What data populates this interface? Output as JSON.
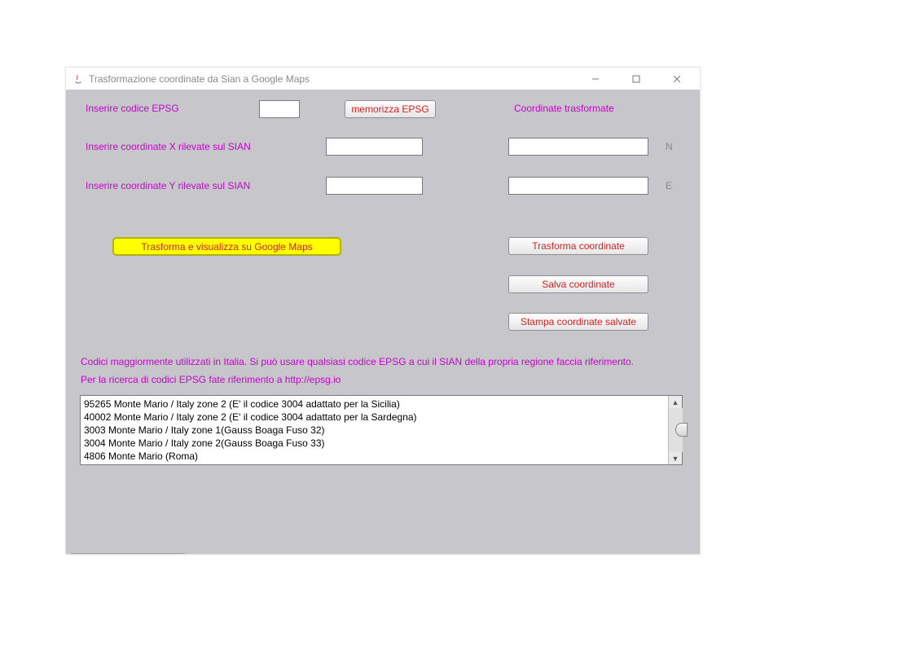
{
  "window": {
    "title": "Trasformazione coordinate da Sian a Google Maps"
  },
  "labels": {
    "epsg": "Inserire codice EPSG",
    "memorizza": "memorizza EPSG",
    "coord_trasformate": "Coordinate trasformate",
    "x_sian": "Inserire coordinate X rilevate sul SIAN",
    "y_sian": "Inserire coordinate Y rilevate sul SIAN",
    "n": "N",
    "e": "E"
  },
  "buttons": {
    "trasforma_visualizza": "Trasforma e visualizza su Google Maps",
    "trasforma_coordinate": "Trasforma coordinate",
    "salva_coordinate": "Salva coordinate",
    "stampa_coordinate": "Stampa coordinate salvate"
  },
  "info": {
    "line1": "Codici maggiormente utilizzati in Italia. Si può usare qualsiasi codice EPSG a cui il SIAN della propria regione faccia riferimento.",
    "line2": "Per la ricerca di codici EPSG fate riferimento a  http://epsg.io"
  },
  "list": [
    "95265 Monte Mario / Italy zone 2 (E' il codice 3004 adattato per la Sicilia)",
    "40002 Monte Mario / Italy zone 2 (E' il codice 3004 adattato per la Sardegna)",
    "3003 Monte Mario / Italy zone 1(Gauss Boaga Fuso 32)",
    "3004 Monte Mario / Italy zone 2(Gauss Boaga Fuso 33)",
    "4806 Monte Mario (Roma)"
  ],
  "inputs": {
    "epsg": "",
    "x_in": "",
    "y_in": "",
    "n_out": "",
    "e_out": ""
  }
}
